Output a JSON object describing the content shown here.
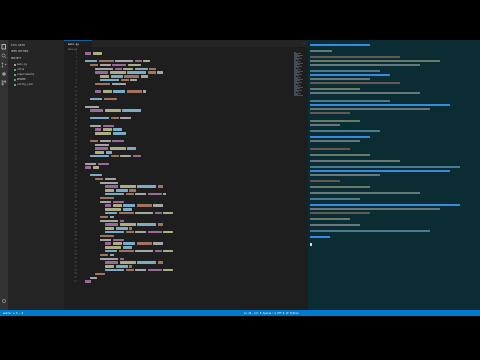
{
  "sidebar": {
    "header": "EXPLORER",
    "section_open": "OPEN EDITORS",
    "section_project": "PROJECT",
    "files": [
      {
        "name": "main.py",
        "color": "#e2c08d"
      },
      {
        "name": "utils",
        "color": "#73c991"
      },
      {
        "name": "requirements",
        "color": "#73c991"
      },
      {
        "name": "README",
        "color": "#73c991"
      },
      {
        "name": "config.json",
        "color": "#73c991"
      }
    ]
  },
  "editor": {
    "tab_label": "main.py",
    "tab_actions": "⋯",
    "breadcrumb": "main.py"
  },
  "status": {
    "left": "master ⊘ 0 ⚠ 0",
    "right": "Ln 42, Col 8  Spaces: 4  UTF-8  LF  Python"
  },
  "colors": {
    "accent": "#007acc",
    "terminal_bg": "#0c2c33",
    "keyword": "#c586c0",
    "string": "#ce9178",
    "function": "#dcdcaa",
    "variable": "#9cdcfe",
    "plain": "#d4d4d4",
    "comment": "#6a9955",
    "term_header": "#3b8eea"
  },
  "icons": [
    "files-icon",
    "search-icon",
    "source-control-icon",
    "debug-icon",
    "extensions-icon",
    "settings-icon"
  ]
}
